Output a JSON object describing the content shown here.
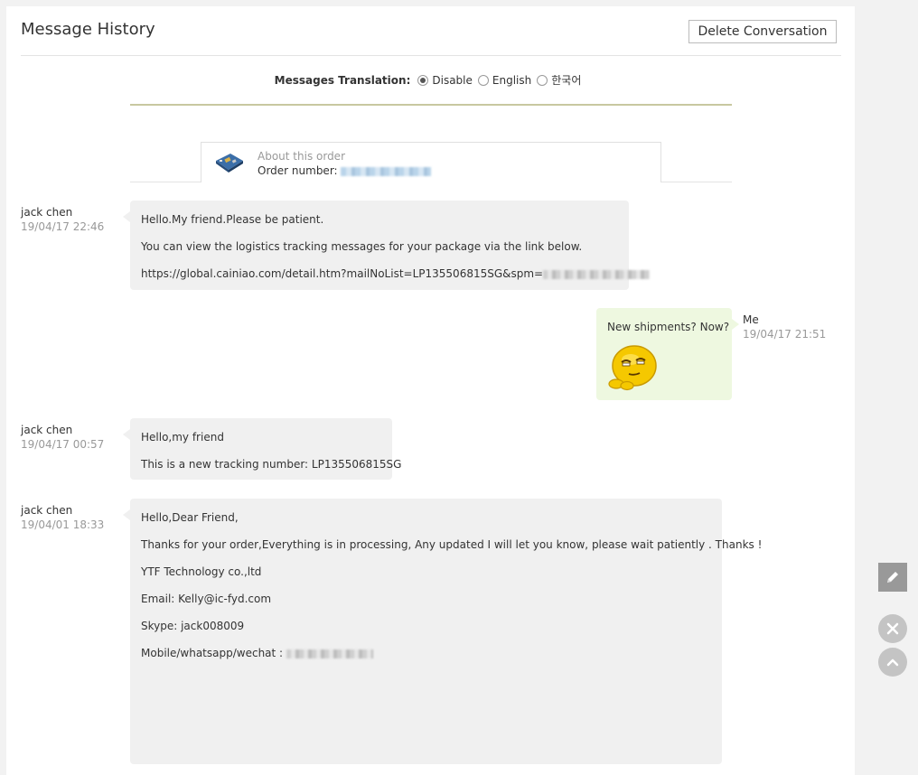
{
  "page": {
    "title": "Message History",
    "delete_label": "Delete Conversation"
  },
  "translation": {
    "label": "Messages Translation:",
    "options": [
      {
        "label": "Disable",
        "checked": true
      },
      {
        "label": "English",
        "checked": false
      },
      {
        "label": "한국어",
        "checked": false
      }
    ]
  },
  "order": {
    "about": "About this order",
    "number_label": "Order number:"
  },
  "messages": [
    {
      "sender": "jack chen",
      "time": "19/04/17 22:46",
      "lines": [
        "Hello.My friend.Please be patient.",
        "You can view the logistics tracking messages for your package via the link below.",
        "https://global.cainiao.com/detail.htm?mailNoList=LP135506815SG&spm="
      ]
    },
    {
      "sender": "Me",
      "time": "19/04/17 21:51",
      "lines": [
        "New shipments? Now?"
      ]
    },
    {
      "sender": "jack chen",
      "time": "19/04/17 00:57",
      "lines": [
        "Hello,my friend",
        "This is a new tracking number:  LP135506815SG"
      ]
    },
    {
      "sender": "jack chen",
      "time": "19/04/01 18:33",
      "lines": [
        "Hello,Dear Friend,",
        "Thanks for your order,Everything is in processing, Any updated I will let you know, please wait patiently . Thanks !",
        "YTF Technology co.,ltd",
        "Email:  Kelly@ic-fyd.com",
        "Skype: jack008009",
        "Mobile/whatsapp/wechat :"
      ]
    }
  ],
  "icons": {
    "edit": "pencil-icon",
    "close": "close-icon",
    "top": "chevron-up-icon"
  }
}
